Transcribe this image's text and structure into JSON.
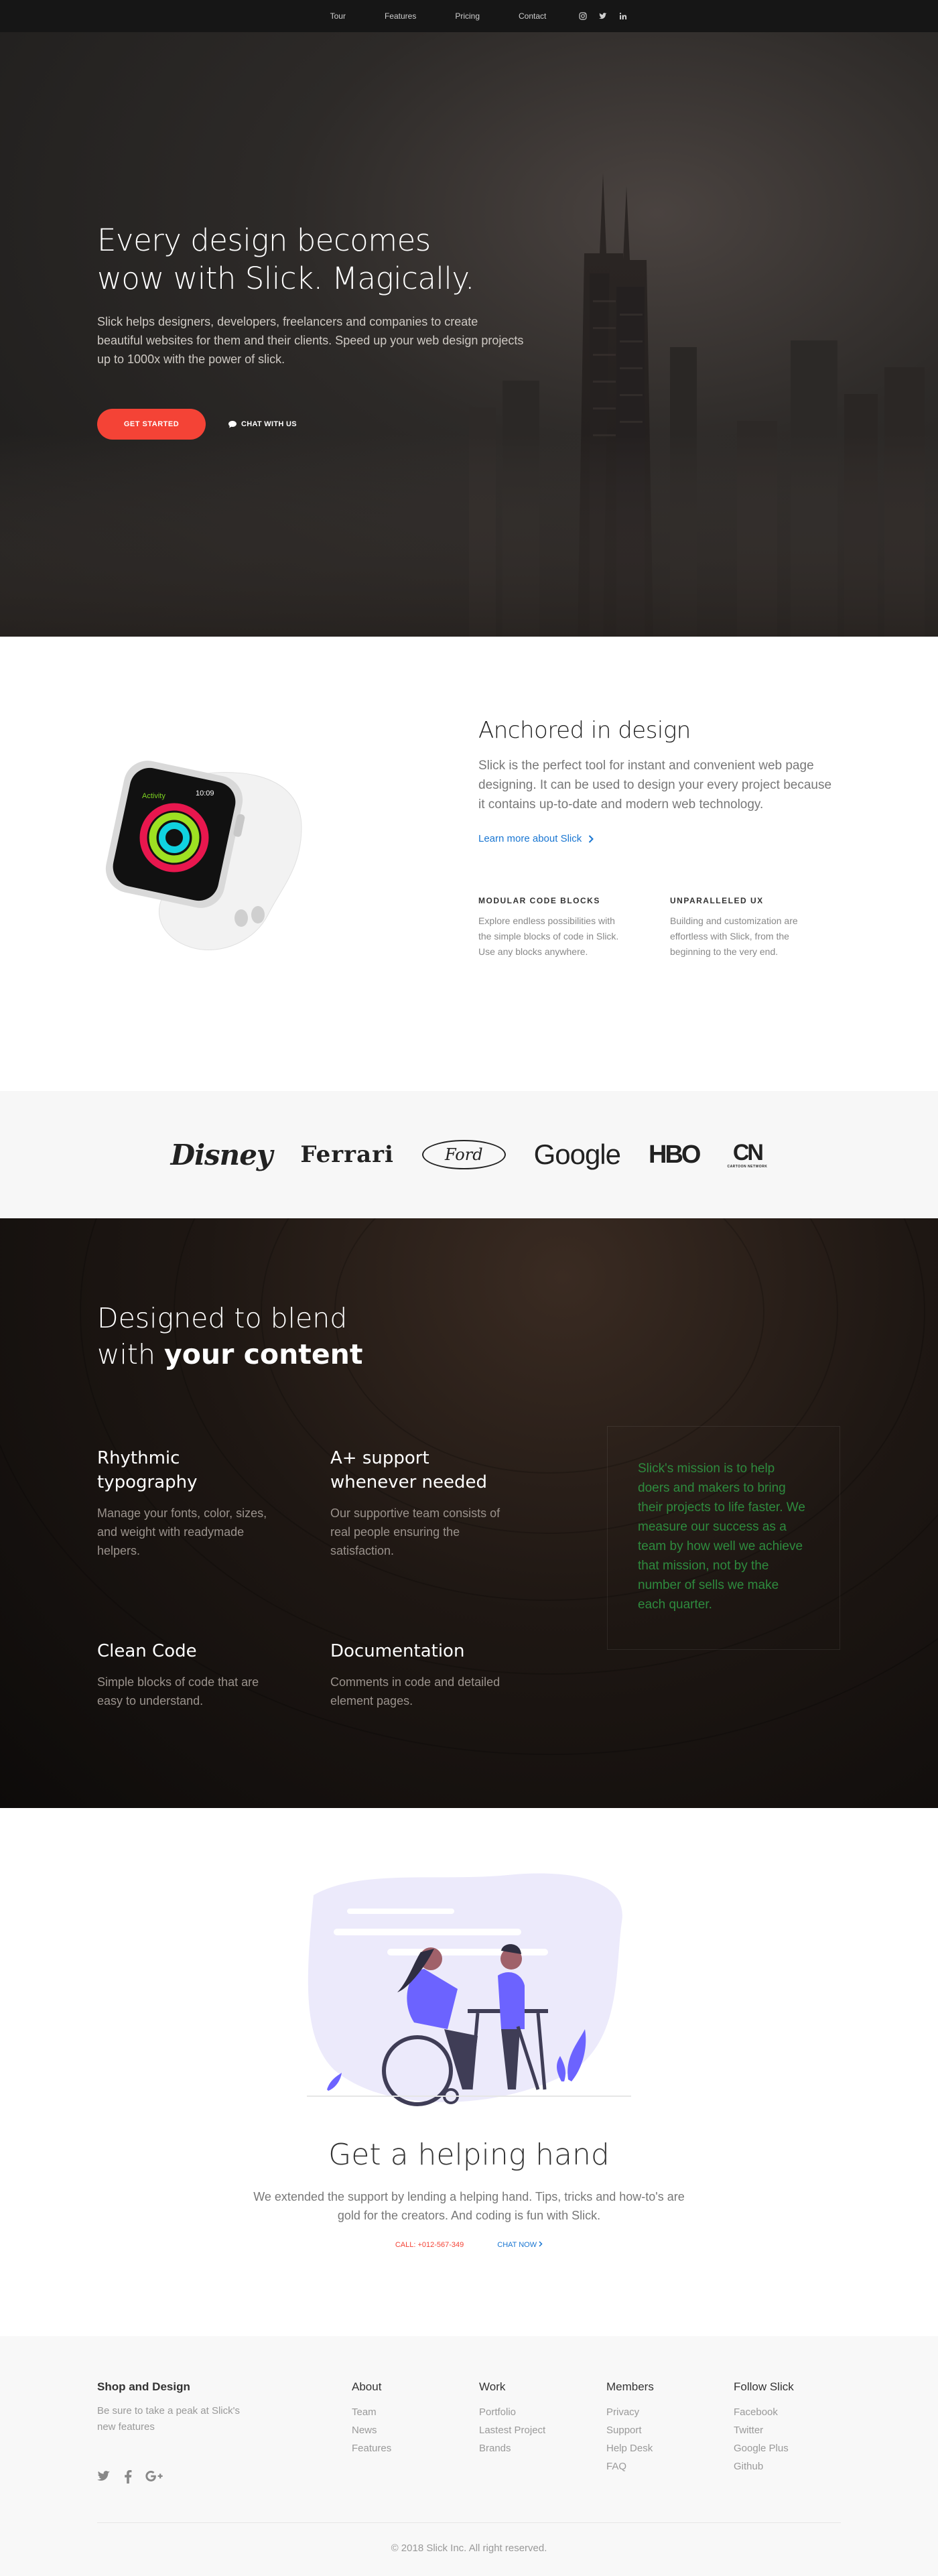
{
  "nav": {
    "links": [
      "Tour",
      "Features",
      "Pricing",
      "Contact"
    ],
    "social_icons": [
      "instagram-icon",
      "twitter-icon",
      "linkedin-icon"
    ]
  },
  "hero": {
    "title_line1": "Every design becomes",
    "title_line2": "wow with Slick. Magically.",
    "lead": "Slick helps designers, developers, freelancers and companies to create beautiful websites for them and their clients. Speed up your web design projects up to 1000x with the power of slick.",
    "cta_label": "GET STARTED",
    "chat_label": "CHAT WITH US"
  },
  "anchored": {
    "title": "Anchored in design",
    "description": "Slick is the perfect tool for instant and convenient web page designing. It can be used to design your every project because it contains up-to-date and modern web technology.",
    "learn_more": "Learn more about Slick",
    "watch_time": "10:09",
    "watch_app": "Activity",
    "features": [
      {
        "title": "MODULAR CODE BLOCKS",
        "text": "Explore endless possibilities with the simple blocks of code in Slick. Use any blocks anywhere."
      },
      {
        "title": "UNPARALLELED UX",
        "text": "Building and customization are effortless with Slick, from the beginning to the very end."
      }
    ]
  },
  "brands": {
    "disney": "Disney",
    "ferrari": "Ferrari",
    "ford": "Ford",
    "google": "Google",
    "hbo": "HBO",
    "cn": "CN",
    "cn_sub": "CARTOON NETWORK"
  },
  "blend": {
    "title_line1": "Designed to blend",
    "title_line2_prefix": "with ",
    "title_line2_bold": "your content",
    "items": [
      {
        "title": "Rhythmic typography",
        "text": "Manage your fonts, color, sizes, and weight with readymade helpers."
      },
      {
        "title": "A+ support whenever needed",
        "text": "Our supportive team consists of real people ensuring the satisfaction."
      },
      {
        "title": "Clean Code",
        "text": "Simple blocks of code that are easy to understand."
      },
      {
        "title": "Documentation",
        "text": "Comments in code and detailed element pages."
      }
    ],
    "mission": "Slick's mission is to help doers and makers to bring their projects to life faster. We measure our success as a team by how well we achieve that mission, not by the number of sells we make each quarter."
  },
  "help": {
    "title": "Get a helping hand",
    "description": "We extended the support by lending a helping hand. Tips, tricks and how-to's are gold for the creators. And coding is fun with Slick.",
    "call": "CALL: +012-567-349",
    "chat": "CHAT NOW"
  },
  "footer": {
    "brand_title": "Shop and Design",
    "brand_blurb": "Be sure to take a peak at Slick's new features",
    "social_icons": [
      "twitter-icon",
      "facebook-icon",
      "google-plus-icon"
    ],
    "columns": [
      {
        "title": "About",
        "links": [
          "Team",
          "News",
          "Features"
        ]
      },
      {
        "title": "Work",
        "links": [
          "Portfolio",
          "Lastest Project",
          "Brands"
        ]
      },
      {
        "title": "Members",
        "links": [
          "Privacy",
          "Support",
          "Help Desk",
          "FAQ"
        ]
      },
      {
        "title": "Follow Slick",
        "links": [
          "Facebook",
          "Twitter",
          "Google Plus",
          "Github"
        ]
      }
    ],
    "copyright": "© 2018 Slick Inc. All right reserved."
  },
  "colors": {
    "accent_red": "#f44336",
    "link_blue": "#1976d2",
    "mission_green": "#2e8b3e",
    "illustration_purple": "#6c63ff"
  }
}
